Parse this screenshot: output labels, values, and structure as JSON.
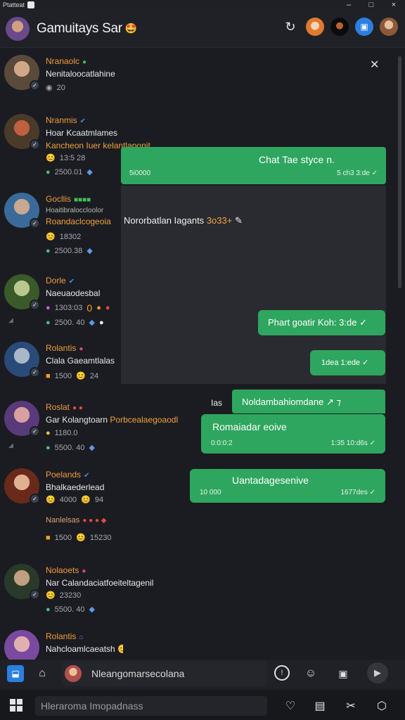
{
  "window": {
    "title": "Ptatteat",
    "controls": [
      "–",
      "□",
      "×"
    ]
  },
  "header": {
    "title": "Gamuitays Sar",
    "title_emoji": "🤩",
    "icons": [
      "refresh-icon",
      "avatar-chip-icon",
      "avatar-chip-icon",
      "calendar-icon",
      "profile-avatar-icon"
    ]
  },
  "contacts": [
    {
      "name": "Nranaolc",
      "status": "●",
      "status_color": "#3fbf5a",
      "line1": "Nenitaloocatlahine",
      "line2": "",
      "meta1": [
        "◉",
        "20"
      ],
      "meta2": []
    },
    {
      "name": "Nranmis",
      "status": "✔",
      "status_color": "#3a8ee0",
      "line1": "Hoar Kcaatmlames",
      "line2": "Kancheon Iuer kelantlaponit",
      "meta1": [
        "😊",
        "13:5 28"
      ],
      "meta2": [
        "●",
        "2500.01",
        "◆"
      ]
    },
    {
      "name": "Gocllis",
      "status": "■■■■",
      "status_color": "#3fbf5a",
      "line1": "Hoaitibraloccloolor",
      "line2": "Roandaclcogeoia",
      "meta1": [
        "😊",
        "18302"
      ],
      "meta2": [
        "●",
        "2500.38",
        "◆"
      ]
    },
    {
      "name": "Dorle",
      "status": "✔",
      "status_color": "#3a8ee0",
      "line1": "Naeuaodesbal",
      "line2": "",
      "meta1": [
        "●",
        "1303:03",
        "0",
        "●",
        "●"
      ],
      "meta2": [
        "●",
        "2500. 40",
        "◆",
        "●"
      ]
    },
    {
      "name": "Rolantis",
      "status": "●",
      "status_color": "#e04a6a",
      "line1": "Clala Gaeamtlalas",
      "line2": "",
      "meta1": [
        "■",
        "1500",
        "😊",
        "24"
      ],
      "meta2": []
    },
    {
      "name": "Roslat",
      "status": "● ●",
      "status_color": "#e04a4a",
      "line1": "Gar Kolangtoarn",
      "line2_inline": "Porbcealaegoaodl",
      "meta1": [
        "●",
        "1180.0"
      ],
      "meta2": [
        "●",
        "5500. 40",
        "◆"
      ]
    },
    {
      "name": "Poelands",
      "status": "✔",
      "status_color": "#3a8ee0",
      "line1": "Bhalkaederlead",
      "line2": "",
      "meta1": [
        "😊",
        "4000",
        "😊",
        "94"
      ],
      "meta2": []
    },
    {
      "name": "Nanlelsas",
      "status": "● ● ● ◆",
      "status_color": "#e04a4a",
      "line1": "",
      "line2": "",
      "meta1": [
        "■",
        "1500",
        "😊",
        "15230"
      ],
      "meta2": []
    },
    {
      "name": "Nolaoets",
      "status": "●",
      "status_color": "#e04a6a",
      "line1": "Nar Calandaciatfoeiteltagenil",
      "line2": "",
      "meta1": [
        "😊",
        "23230"
      ],
      "meta2": [
        "●",
        "5500. 40",
        "◆"
      ]
    },
    {
      "name": "Rolantis",
      "status": "⌂",
      "status_color": "#7a7ad8",
      "line1": "Nahcloamlcaeatsh",
      "line2": "",
      "meta1": [
        "😊",
        "●",
        "●"
      ],
      "meta2": []
    }
  ],
  "messages": [
    {
      "text": "Chat Tae styce n.",
      "left_time": "5i0000",
      "right_time": "5 ch3 3:de ✓"
    },
    {
      "text": "Nororbatlan Iagants",
      "suffix": "3o33+",
      "suffix_icon": "✎"
    },
    {
      "text": "Phart goatir Koh: 3:de ✓"
    },
    {
      "text": "1dea 1:ede ✓"
    },
    {
      "header_left": "Ias",
      "header_text": "Noldambahiomdane ↗ ⁊",
      "text": "Romaiadar eoive",
      "left_time": "0:0:0:2",
      "right_time": "1:35 10:d6s ✓"
    },
    {
      "text": "Uantadagesenive",
      "left_time": "10 000",
      "right_time": "1677des ✓"
    }
  ],
  "composer": {
    "placeholder": "Nleangomarsecolana"
  },
  "taskbar": {
    "search_placeholder": "Hleraroma Imopadnass"
  }
}
